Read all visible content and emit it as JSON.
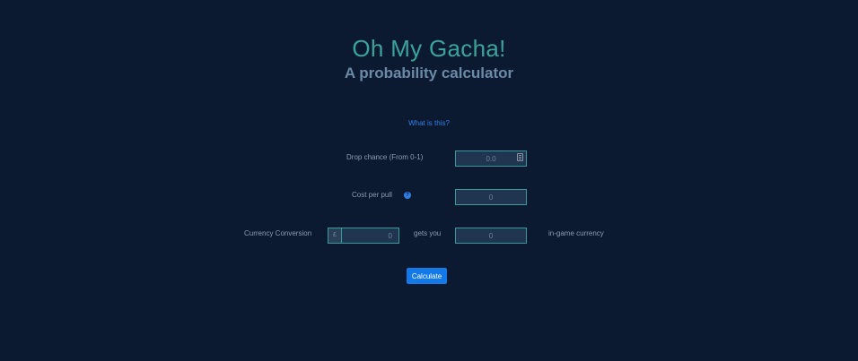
{
  "header": {
    "title": "Oh My Gacha!",
    "subtitle": "A probability calculator"
  },
  "info_link": "What is this?",
  "form": {
    "drop_chance": {
      "label": "Drop chance (From 0-1)",
      "placeholder": "0.0"
    },
    "cost_per_pull": {
      "label": "Cost per pull",
      "placeholder": "0"
    },
    "currency_conversion": {
      "label": "Currency Conversion",
      "prefix": "£",
      "placeholder": "0",
      "middle_text": "gets you",
      "ingame_placeholder": "0",
      "suffix_text": "in-game currency"
    }
  },
  "calculate_button": "Calculate",
  "icons": {
    "help": "question-circle-icon",
    "spinner": "number-spinner-icon"
  },
  "colors": {
    "background": "#0c1a31",
    "title": "#3aa39a",
    "accent": "#1479e8",
    "input_border": "#3a9a9b"
  }
}
